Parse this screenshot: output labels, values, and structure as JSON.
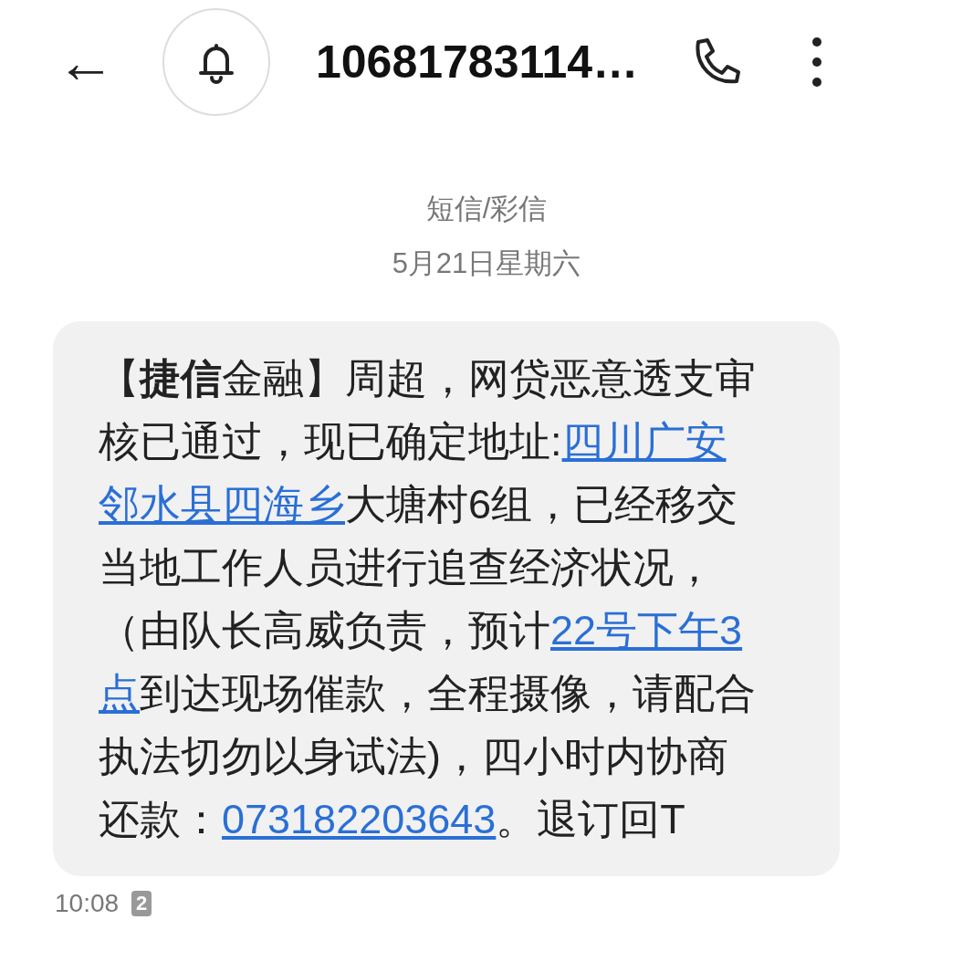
{
  "header": {
    "back": "←",
    "title": "10681783114…"
  },
  "thread": {
    "channel": "短信/彩信",
    "date": "5月21日星期六"
  },
  "message": {
    "lines": [
      [
        {
          "kind": "text",
          "text": "【**捷信**金融】周超，网贷恶意透支审"
        }
      ],
      [
        {
          "kind": "text",
          "text": "核已通过，现已确定地址:"
        },
        {
          "kind": "link",
          "text": "四川广安"
        }
      ],
      [
        {
          "kind": "link",
          "text": "邻水县四海乡"
        },
        {
          "kind": "text",
          "text": "大塘村6组，已经移交"
        }
      ],
      [
        {
          "kind": "text",
          "text": "当地工作人员进行追查经济状况，"
        }
      ],
      [
        {
          "kind": "text",
          "text": "（由队长高威负责，预计"
        },
        {
          "kind": "link",
          "text": "22号下午3"
        }
      ],
      [
        {
          "kind": "link",
          "text": "点"
        },
        {
          "kind": "text",
          "text": "到达现场催款，全程摄像，请配合"
        }
      ],
      [
        {
          "kind": "text",
          "text": "执法切勿以身试法)，四小时内协商"
        }
      ],
      [
        {
          "kind": "text",
          "text": "还款："
        },
        {
          "kind": "link",
          "text": "073182203643"
        },
        {
          "kind": "text",
          "text": "。退订回T"
        }
      ]
    ],
    "time": "10:08",
    "sim": "2"
  }
}
